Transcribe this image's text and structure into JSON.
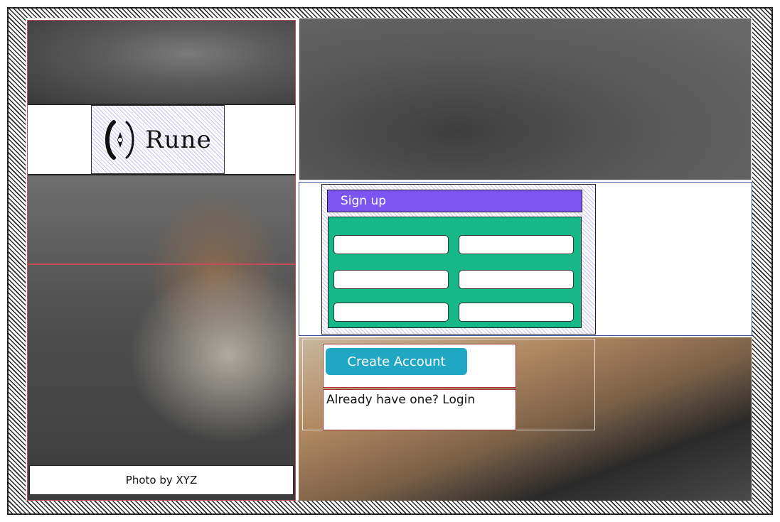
{
  "brand": {
    "name": "Rune"
  },
  "left": {
    "caption": "Photo by XYZ"
  },
  "signup": {
    "title": "Sign up",
    "fields": [
      {
        "value": "",
        "placeholder": ""
      },
      {
        "value": "",
        "placeholder": ""
      },
      {
        "value": "",
        "placeholder": ""
      },
      {
        "value": "",
        "placeholder": ""
      },
      {
        "value": "",
        "placeholder": ""
      },
      {
        "value": "",
        "placeholder": ""
      }
    ]
  },
  "actions": {
    "create_label": "Create Account",
    "login_prompt": "Already have one?",
    "login_link": "Login"
  },
  "colors": {
    "header_purple": "#7a55f2",
    "form_green": "#15b886",
    "button_teal": "#1fa7c4",
    "frame_accent": "#3b4fa8",
    "left_accent": "#c44b5a"
  }
}
